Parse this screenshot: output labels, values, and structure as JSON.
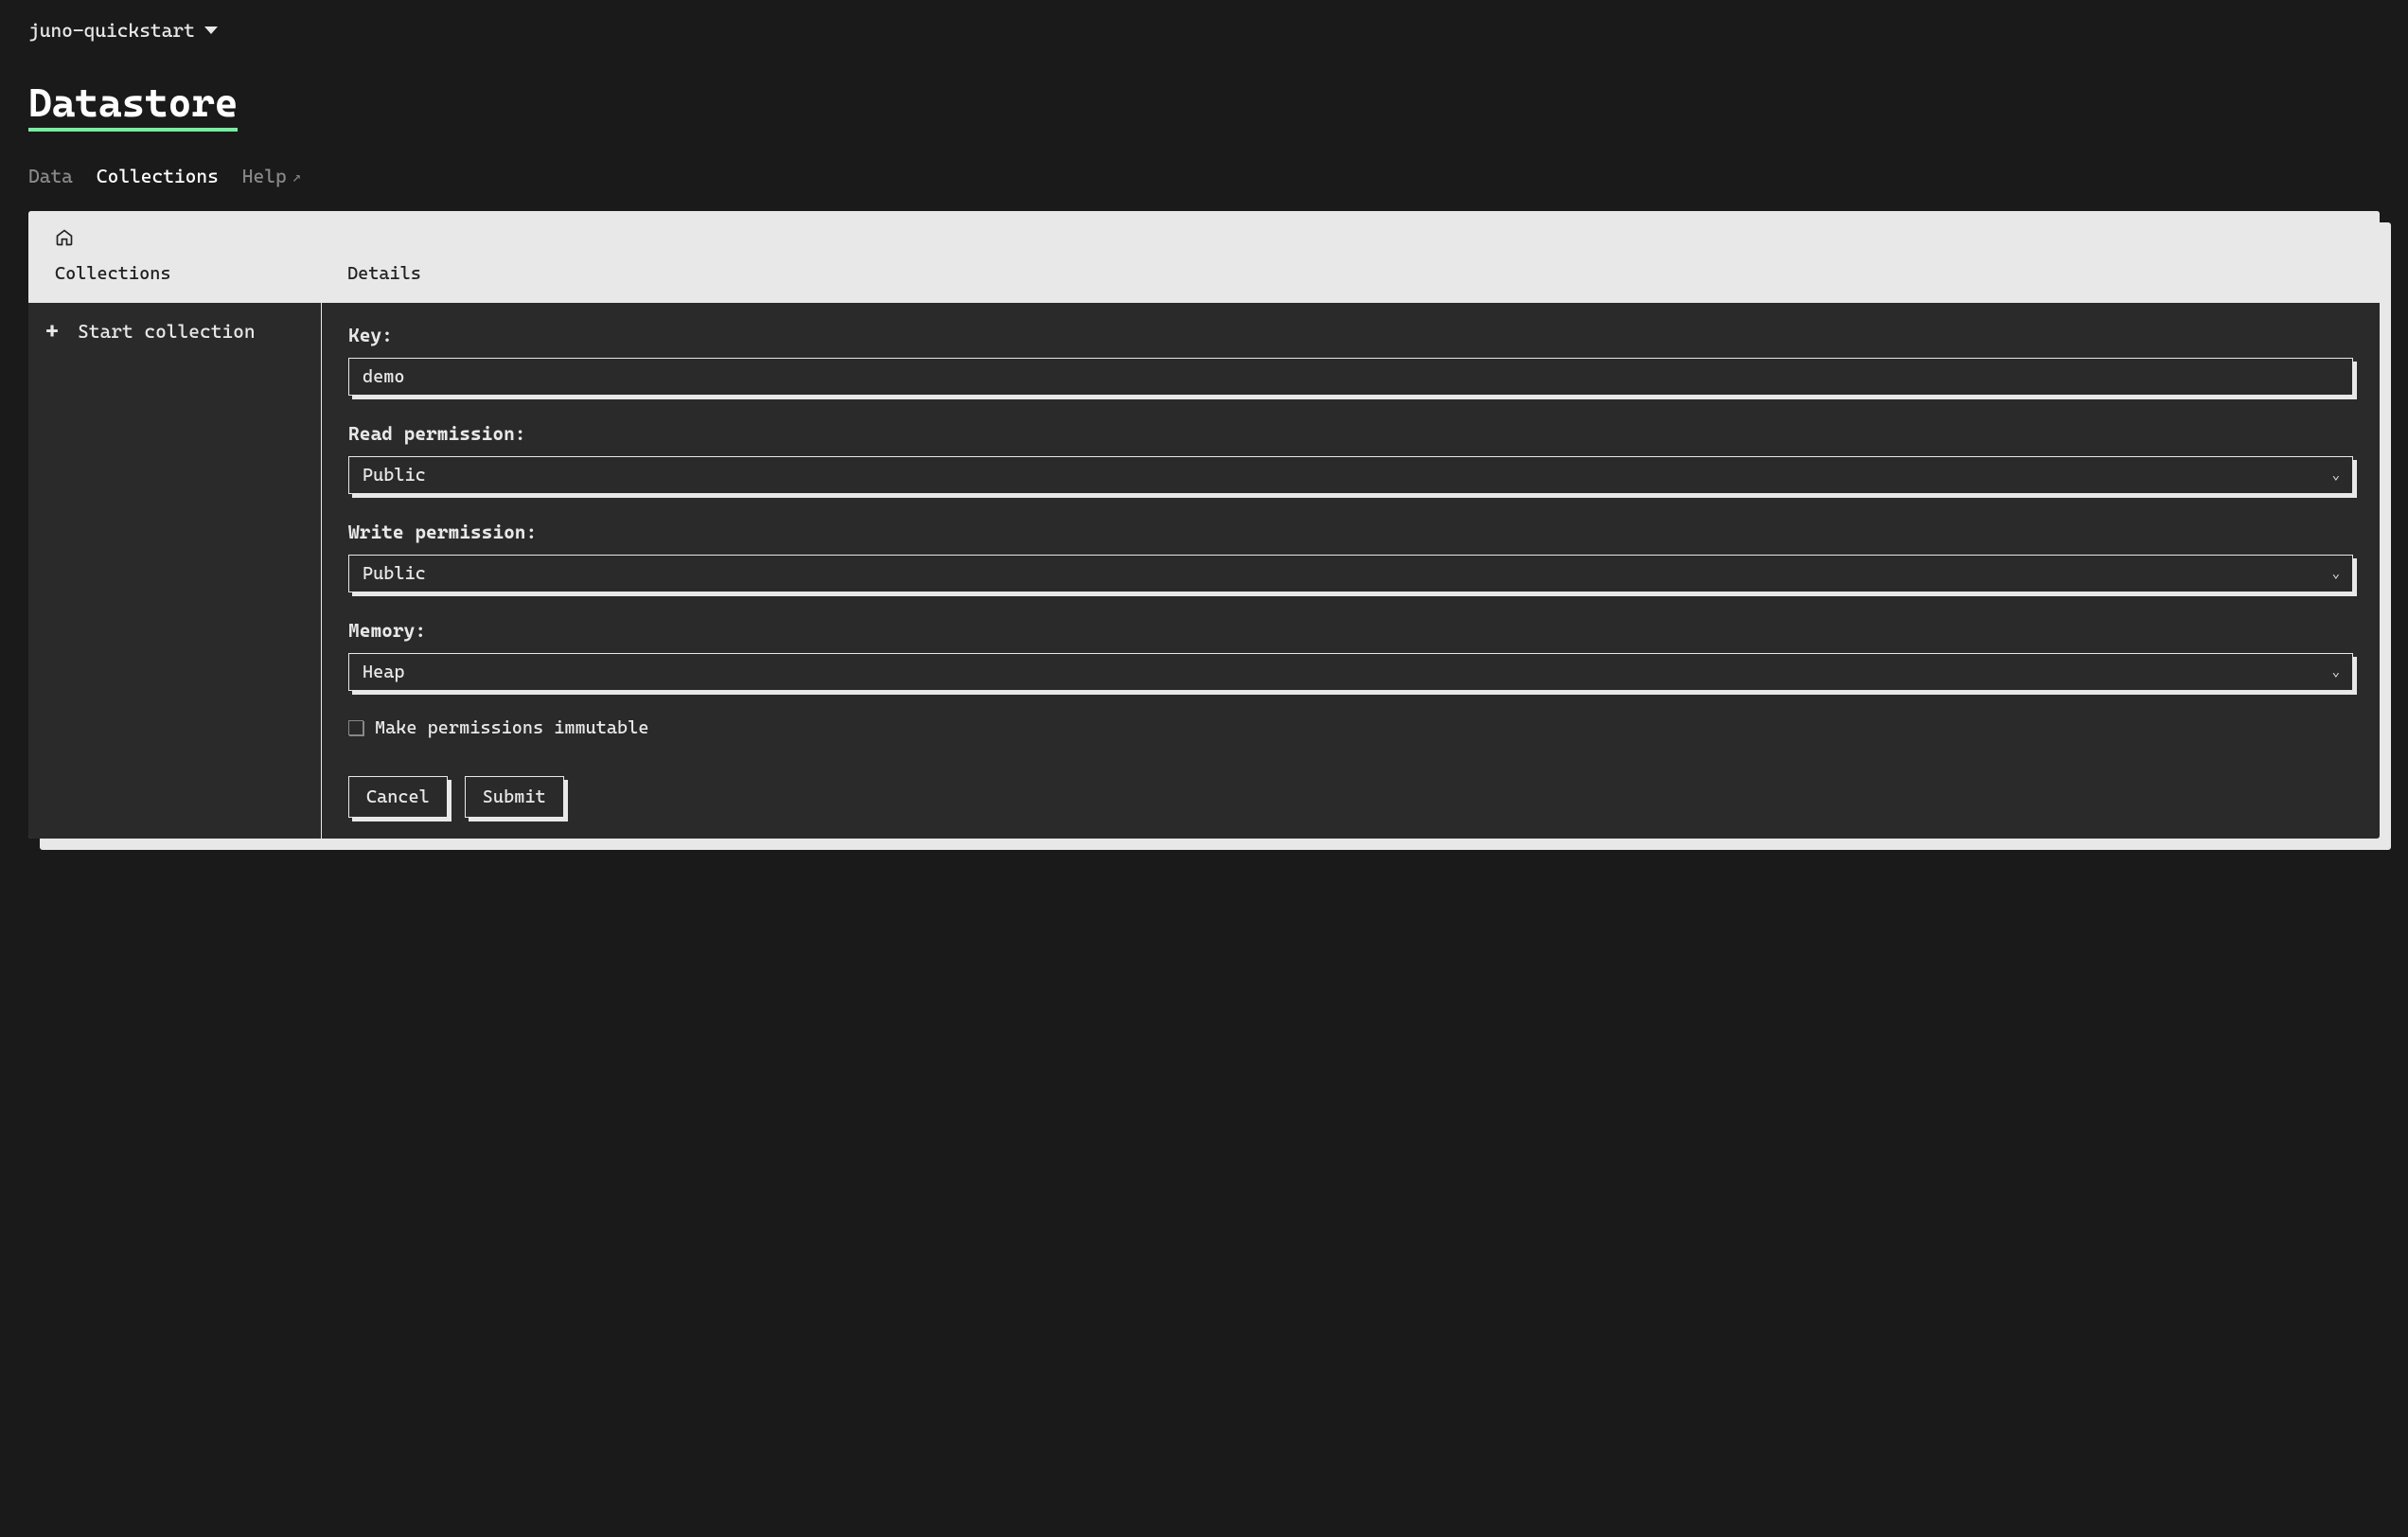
{
  "project": {
    "name": "juno-quickstart"
  },
  "page": {
    "title": "Datastore"
  },
  "tabs": {
    "data": "Data",
    "collections": "Collections",
    "help": "Help"
  },
  "panel": {
    "header_left": "Collections",
    "header_right": "Details"
  },
  "sidebar": {
    "start_collection_label": "Start collection"
  },
  "form": {
    "key": {
      "label": "Key:",
      "value": "demo"
    },
    "read_permission": {
      "label": "Read permission:",
      "value": "Public"
    },
    "write_permission": {
      "label": "Write permission:",
      "value": "Public"
    },
    "memory": {
      "label": "Memory:",
      "value": "Heap"
    },
    "immutable": {
      "label": "Make permissions immutable",
      "checked": false
    },
    "buttons": {
      "cancel": "Cancel",
      "submit": "Submit"
    }
  }
}
